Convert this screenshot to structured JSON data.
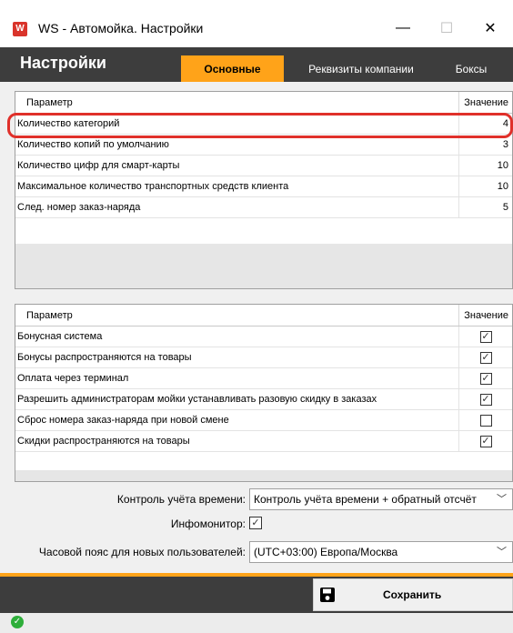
{
  "window": {
    "title": "WS - Автомойка. Настройки",
    "app_icon": "W",
    "minimize": "—",
    "maximize": "☐",
    "close": "✕"
  },
  "header": {
    "title": "Настройки",
    "tabs": [
      {
        "label": "Основные",
        "active": true
      },
      {
        "label": "Реквизиты компании",
        "active": false
      },
      {
        "label": "Боксы",
        "active": false
      }
    ]
  },
  "grid1": {
    "col_param": "Параметр",
    "col_value": "Значение",
    "rows": [
      {
        "param": "Количество категорий",
        "value": "4"
      },
      {
        "param": "Количество копий по умолчанию",
        "value": "3"
      },
      {
        "param": "Количество цифр для смарт-карты",
        "value": "10"
      },
      {
        "param": "Максимальное количество транспортных средств клиента",
        "value": "10"
      },
      {
        "param": "След. номер заказ-наряда",
        "value": "5"
      }
    ]
  },
  "grid2": {
    "col_param": "Параметр",
    "col_value": "Значение",
    "rows": [
      {
        "param": "Бонусная система",
        "checked": true
      },
      {
        "param": "Бонусы распространяются на товары",
        "checked": true
      },
      {
        "param": "Оплата через терминал",
        "checked": true
      },
      {
        "param": "Разрешить администраторам мойки устанавливать разовую скидку в заказах",
        "checked": true
      },
      {
        "param": "Сброс номера заказ-наряда при новой смене",
        "checked": false
      },
      {
        "param": "Скидки распространяются на товары",
        "checked": true
      }
    ]
  },
  "form": {
    "time_control_label": "Контроль учёта времени:",
    "time_control_value": "Контроль учёта времени + обратный отсчёт",
    "infomonitor_label": "Инфомонитор:",
    "infomonitor_checked": true,
    "timezone_label": "Часовой пояс для новых пользователей:",
    "timezone_value": "(UTC+03:00) Европа/Москва"
  },
  "footer": {
    "save_label": "Сохранить"
  },
  "colors": {
    "accent": "#ffa319",
    "dark": "#3d3d3d",
    "highlight": "#e0302a",
    "status_ok": "#2eae3a"
  },
  "icons": {
    "save": "floppy-disk-icon",
    "status": "check-circle-icon",
    "dropdown": "chevron-down-icon"
  }
}
